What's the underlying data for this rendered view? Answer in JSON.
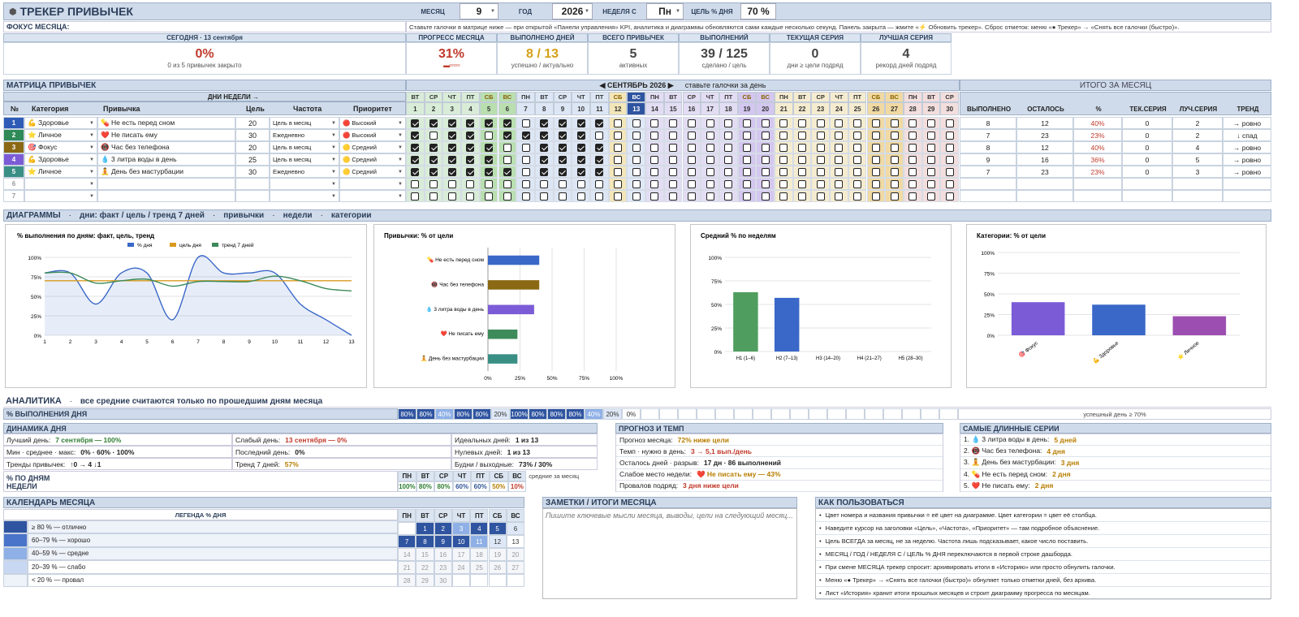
{
  "header": {
    "title": "ТРЕКЕР ПРИВЫЧЕК",
    "month_label": "МЕСЯЦ",
    "month": "9",
    "year_label": "ГОД",
    "year": "2026",
    "week_label": "НЕДЕЛЯ С",
    "week": "Пн",
    "goal_label": "ЦЕЛЬ % ДНЯ",
    "goal": "70 %"
  },
  "focus": {
    "label": "ФОКУС МЕСЯЦА:",
    "hint": "Ставьте галочки в матрице ниже — при открытой «Панели управления» KPI, аналитика и диаграммы обновляются сами каждые несколько секунд. Панель закрыта — жмите «⚡ Обновить трекер». Сброс отметок: меню «● Трекер» → «Снять все галочки (быстро)»."
  },
  "today": {
    "label": "СЕГОДНЯ · 13 сентября",
    "value": "0%",
    "sub": "0 из 5 привычек закрыто"
  },
  "kpis": [
    {
      "title": "ПРОГРЕСС МЕСЯЦА",
      "value": "31%",
      "sub": "▬▫▫▫▫▫▫▫",
      "color": "#c0392b"
    },
    {
      "title": "ВЫПОЛНЕНО ДНЕЙ",
      "value": "8 / 13",
      "sub": "успешно / актуально",
      "color": "#d4a017"
    },
    {
      "title": "ВСЕГО ПРИВЫЧЕК",
      "value": "5",
      "sub": "активных",
      "color": "#444"
    },
    {
      "title": "ВЫПОЛНЕНИЙ",
      "value": "39 / 125",
      "sub": "сделано / цель",
      "color": "#444"
    },
    {
      "title": "ТЕКУЩАЯ СЕРИЯ",
      "value": "0",
      "sub": "дни ≥ цели подряд",
      "color": "#444"
    },
    {
      "title": "ЛУЧШАЯ СЕРИЯ",
      "value": "4",
      "sub": "рекорд дней подряд",
      "color": "#444"
    }
  ],
  "matrix": {
    "title": "МАТРИЦА ПРИВЫЧЕК",
    "days_label": "ДНИ НЕДЕЛИ →",
    "month_title": "◀ СЕНТЯБРЬ 2026 ▶",
    "month_hint": "ставьте галочки за день",
    "totals_title": "ИТОГО ЗА МЕСЯЦ",
    "cols": {
      "num": "№",
      "cat": "Категория",
      "habit": "Привычка",
      "goal": "Цель",
      "freq": "Частота",
      "prio": "Приоритет"
    },
    "tcols": [
      "ВЫПОЛНЕНО",
      "ОСТАЛОСЬ",
      "%",
      "ТЕК.СЕРИЯ",
      "ЛУЧ.СЕРИЯ",
      "ТРЕНД"
    ],
    "dows": [
      "ВТ",
      "СР",
      "ЧТ",
      "ПТ",
      "СБ",
      "ВС",
      "ПН",
      "ВТ",
      "СР",
      "ЧТ",
      "ПТ",
      "СБ",
      "ВС",
      "ПН",
      "ВТ",
      "СР",
      "ЧТ",
      "ПТ",
      "СБ",
      "ВС",
      "ПН",
      "ВТ",
      "СР",
      "ЧТ",
      "ПТ",
      "СБ",
      "ВС",
      "ПН",
      "ВТ",
      "СР"
    ],
    "days": [
      "1",
      "2",
      "3",
      "4",
      "5",
      "6",
      "7",
      "8",
      "9",
      "10",
      "11",
      "12",
      "13",
      "14",
      "15",
      "16",
      "17",
      "18",
      "19",
      "20",
      "21",
      "22",
      "23",
      "24",
      "25",
      "26",
      "27",
      "28",
      "29",
      "30"
    ],
    "rows": [
      {
        "n": "1",
        "ncolor": "#2f5bb7",
        "cat": "💪 Здоровье",
        "habit": "💊 Не есть перед сном",
        "goal": "20",
        "freq": "Цель в месяц",
        "prio": "🔴 Высокий",
        "checks": "1111110111100",
        "done": "8",
        "left": "12",
        "pct": "40%",
        "cur": "0",
        "best": "2",
        "trend": "→ ровно"
      },
      {
        "n": "2",
        "ncolor": "#2e8b57",
        "cat": "⭐ Личное",
        "habit": "❤️ Не писать ему",
        "goal": "30",
        "freq": "Ежедневно",
        "prio": "🔴 Высокий",
        "checks": "1011011111000",
        "done": "7",
        "left": "23",
        "pct": "23%",
        "cur": "0",
        "best": "2",
        "trend": "↓ спад"
      },
      {
        "n": "3",
        "ncolor": "#8b6914",
        "cat": "🎯 Фокус",
        "habit": "📵 Час без телефона",
        "goal": "20",
        "freq": "Цель в месяц",
        "prio": "🟡 Средний",
        "checks": "1111100111100",
        "done": "8",
        "left": "12",
        "pct": "40%",
        "cur": "0",
        "best": "4",
        "trend": "→ ровно"
      },
      {
        "n": "4",
        "ncolor": "#7b5cd6",
        "cat": "💪 Здоровье",
        "habit": "💧 3 литра воды в день",
        "goal": "25",
        "freq": "Цель в месяц",
        "prio": "🟡 Средний",
        "checks": "1111100111100",
        "done": "9",
        "left": "16",
        "pct": "36%",
        "cur": "0",
        "best": "5",
        "trend": "→ ровно"
      },
      {
        "n": "5",
        "ncolor": "#3a8f85",
        "cat": "⭐ Личное",
        "habit": "🧘 День без мастурбации",
        "goal": "30",
        "freq": "Ежедневно",
        "prio": "🟡 Средний",
        "checks": "1111110111100",
        "done": "7",
        "left": "23",
        "pct": "23%",
        "cur": "0",
        "best": "3",
        "trend": "→ ровно"
      },
      {
        "n": "6",
        "ncolor": "",
        "cat": "",
        "habit": "",
        "goal": "",
        "freq": "",
        "prio": "",
        "checks": "",
        "done": "",
        "left": "",
        "pct": "",
        "cur": "",
        "best": "",
        "trend": ""
      },
      {
        "n": "7",
        "ncolor": "",
        "cat": "",
        "habit": "",
        "goal": "",
        "freq": "",
        "prio": "",
        "checks": "",
        "done": "",
        "left": "",
        "pct": "",
        "cur": "",
        "best": "",
        "trend": ""
      }
    ]
  },
  "charts_bar": {
    "title": "ДИАГРАММЫ",
    "tabs": [
      "дни: факт / цель / тренд 7 дней",
      "привычки",
      "недели",
      "категории"
    ]
  },
  "chart_data": [
    {
      "type": "line",
      "title": "% выполнения по дням: факт, цель, тренд",
      "x": [
        1,
        2,
        3,
        4,
        5,
        6,
        7,
        8,
        9,
        10,
        11,
        12,
        13
      ],
      "ylim": [
        0,
        100
      ],
      "yticks": [
        "0%",
        "25%",
        "50%",
        "75%",
        "100%"
      ],
      "series": [
        {
          "name": "% дня",
          "color": "#3a68c8",
          "values": [
            80,
            80,
            40,
            80,
            80,
            20,
            100,
            80,
            80,
            80,
            40,
            20,
            0
          ]
        },
        {
          "name": "цель дня",
          "color": "#d89a1e",
          "values": [
            70,
            70,
            70,
            70,
            70,
            70,
            70,
            70,
            70,
            70,
            70,
            70,
            70
          ]
        },
        {
          "name": "тренд 7 дней",
          "color": "#3d8a5a",
          "values": [
            80,
            80,
            67,
            70,
            72,
            63,
            69,
            69,
            69,
            76,
            70,
            60,
            57
          ]
        }
      ]
    },
    {
      "type": "bar",
      "title": "Привычки: % от цели",
      "categories": [
        "💊 Не есть перед сном",
        "📵 Час без телефона",
        "💧 3 литра воды в день",
        "❤️ Не писать ему",
        "🧘 День без мастурбации"
      ],
      "values": [
        40,
        40,
        36,
        23,
        23
      ],
      "colors": [
        "#3a68c8",
        "#8b6914",
        "#7b5cd6",
        "#3d8a5a",
        "#3a8f85"
      ],
      "xlim": [
        0,
        100
      ],
      "xticks": [
        "0%",
        "25%",
        "50%",
        "75%",
        "100%"
      ]
    },
    {
      "type": "bar",
      "title": "Средний % по неделям",
      "categories": [
        "Н1 (1–6)",
        "Н2 (7–13)",
        "Н3 (14–20)",
        "Н4 (21–27)",
        "Н5 (28–30)"
      ],
      "values": [
        63,
        57,
        0,
        0,
        0
      ],
      "colors": [
        "#4f9e5f",
        "#3a68c8",
        "#3a68c8",
        "#3a68c8",
        "#3a68c8"
      ],
      "ylim": [
        0,
        100
      ],
      "yticks": [
        "0%",
        "25%",
        "50%",
        "75%",
        "100%"
      ]
    },
    {
      "type": "bar",
      "title": "Категории: % от цели",
      "categories": [
        "🎯 Фокус",
        "💪 Здоровье",
        "⭐ Личное"
      ],
      "values": [
        40,
        37,
        23
      ],
      "colors": [
        "#7b5cd6",
        "#3a68c8",
        "#9c4fb0"
      ],
      "ylim": [
        0,
        100
      ],
      "yticks": [
        "0%",
        "25%",
        "50%",
        "75%",
        "100%"
      ]
    }
  ],
  "analytics": {
    "title": "АНАЛИТИКА",
    "hint": "все средние считаются только по прошедшим дням месяца",
    "row_label": "% ВЫПОЛНЕНИЯ ДНЯ",
    "day_pcts": [
      "80%",
      "80%",
      "40%",
      "80%",
      "80%",
      "20%",
      "100%",
      "80%",
      "80%",
      "80%",
      "40%",
      "20%",
      "0%"
    ],
    "success_label": "успешный день ≥ 70%"
  },
  "dynamics": {
    "title": "ДИНАМИКА ДНЯ",
    "rows": [
      [
        {
          "k": "Лучший день:",
          "v": "7 сентября — 100%",
          "cls": "green"
        },
        {
          "k": "Слабый день:",
          "v": "13 сентября — 0%",
          "cls": "red"
        },
        {
          "k": "Идеальных дней:",
          "v": "1 из 13",
          "cls": ""
        }
      ],
      [
        {
          "k": "Мин · среднее · макс:",
          "v": "0% · 60% · 100%",
          "cls": ""
        },
        {
          "k": "Последний день:",
          "v": "0%",
          "cls": ""
        },
        {
          "k": "Нулевых дней:",
          "v": "1 из 13",
          "cls": ""
        }
      ],
      [
        {
          "k": "Тренды привычек:",
          "v": "↑0 → 4 ↓1",
          "cls": ""
        },
        {
          "k": "Тренд 7 дней:",
          "v": "57%",
          "cls": "orange"
        },
        {
          "k": "Будни / выходные:",
          "v": "73% / 30%",
          "cls": ""
        }
      ]
    ],
    "wd_label": "% ПО ДНЯМ НЕДЕЛИ",
    "wd_days": [
      "ПН",
      "ВТ",
      "СР",
      "ЧТ",
      "ПТ",
      "СБ",
      "ВС"
    ],
    "wd_vals": [
      "100%",
      "80%",
      "80%",
      "60%",
      "60%",
      "50%",
      "10%"
    ],
    "wd_note": "средние за месяц"
  },
  "forecast": {
    "title": "ПРОГНОЗ И ТЕМП",
    "rows": [
      {
        "k": "Прогноз месяца:",
        "v": "72%  ниже цели",
        "cls": "orange"
      },
      {
        "k": "Темп · нужно в день:",
        "v": "3 → 5,1 вып./день",
        "cls": "red"
      },
      {
        "k": "Осталось дней · разрыв:",
        "v": "17 дн · 86 выполнений",
        "cls": ""
      },
      {
        "k": "Слабое место недели:",
        "v": "❤️ Не писать ему — 43%",
        "cls": "orange"
      },
      {
        "k": "Провалов подряд:",
        "v": "3 дня ниже цели",
        "cls": "red"
      }
    ]
  },
  "streaks": {
    "title": "САМЫЕ ДЛИННЫЕ СЕРИИ",
    "items": [
      {
        "k": "1. 💧 3 литра воды в день:",
        "v": "5 дней"
      },
      {
        "k": "2. 📵 Час без телефона:",
        "v": "4 дня"
      },
      {
        "k": "3. 🧘 День без мастурбации:",
        "v": "3 дня"
      },
      {
        "k": "4. 💊 Не есть перед сном:",
        "v": "2 дня"
      },
      {
        "k": "5. ❤️ Не писать ему:",
        "v": "2 дня"
      }
    ]
  },
  "calendar": {
    "title": "КАЛЕНДАРЬ МЕСЯЦА",
    "legend_title": "ЛЕГЕНДА % ДНЯ",
    "legend": [
      {
        "label": "≥ 80 % — отлично",
        "color": "#2f54a0"
      },
      {
        "label": "60–79 % — хорошо",
        "color": "#4a74c9"
      },
      {
        "label": "40–59 % — средне",
        "color": "#8fb0e6"
      },
      {
        "label": "20–39 % — слабо",
        "color": "#c9d8f2"
      },
      {
        "label": "< 20 % — провал",
        "color": "#eef2f9"
      }
    ],
    "dows": [
      "ПН",
      "ВТ",
      "СР",
      "ЧТ",
      "ПТ",
      "СБ",
      "ВС"
    ],
    "weeks": [
      [
        "",
        "1",
        "2",
        "3",
        "4",
        "5",
        "6"
      ],
      [
        "7",
        "8",
        "9",
        "10",
        "11",
        "12",
        "13"
      ],
      [
        "14",
        "15",
        "16",
        "17",
        "18",
        "19",
        "20"
      ],
      [
        "21",
        "22",
        "23",
        "24",
        "25",
        "26",
        "27"
      ],
      [
        "28",
        "29",
        "30",
        "",
        "",
        "",
        ""
      ]
    ]
  },
  "notes": {
    "title": "ЗАМЕТКИ / ИТОГИ МЕСЯЦА",
    "placeholder": "Пишите ключевые мысли месяца, выводы, цели на следующий месяц..."
  },
  "howto": {
    "title": "КАК ПОЛЬЗОВАТЬСЯ",
    "items": [
      "Цвет номера и названия привычки = её цвет на диаграмме. Цвет категории = цвет её столбца.",
      "Наведите курсор на заголовки «Цель», «Частота», «Приоритет» — там подробное объяснение.",
      "Цель ВСЕГДА за месяц, не за неделю. Частота лишь подсказывает, какое число поставить.",
      "МЕСЯЦ / ГОД / НЕДЕЛЯ С / ЦЕЛЬ % ДНЯ переключаются в первой строке дашборда.",
      "При смене МЕСЯЦА трекер спросит: архивировать итоги в «Историю» или просто обнулить галочки.",
      "Меню «● Трекер» → «Снять все галочки (быстро)» обнуляет только отметки дней, без архива.",
      "Лист «История» хранит итоги прошлых месяцев и строит диаграмму прогресса по месяцам."
    ]
  }
}
